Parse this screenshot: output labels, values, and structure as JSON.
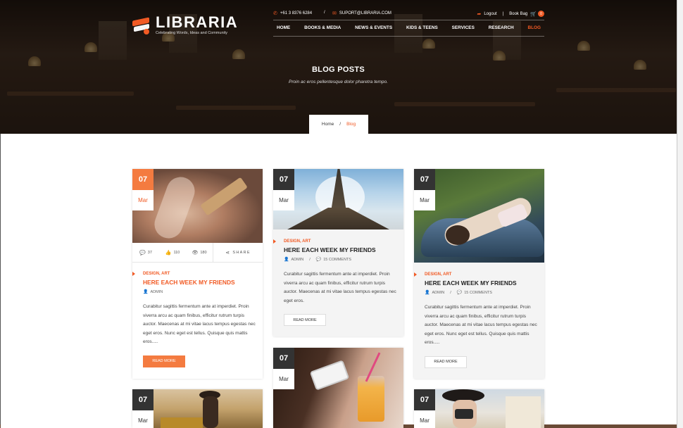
{
  "brand": {
    "name": "LIBRARIA",
    "tagline": "Celebrating Words, Ideas and Community"
  },
  "topbar": {
    "phone": "+61 3 8376 6284",
    "separator": "/",
    "email": "SUPORT@LIBRARIA.COM",
    "logout": "Logout",
    "pipe": "|",
    "bag": "Book Bag",
    "bag_count": "0"
  },
  "nav": [
    "HOME",
    "BOOKS & MEDIA",
    "NEWS & EVENTS",
    "KIDS & TEENS",
    "SERVICES",
    "RESEARCH",
    "BLOG"
  ],
  "hero": {
    "title": "BLOG POSTS",
    "subtitle": "Proin ac eros pellentesque dolor pharetra tempo."
  },
  "breadcrumb": {
    "home": "Home",
    "sep": "/",
    "current": "Blog"
  },
  "colors": {
    "accent": "#f15a24",
    "dark": "#333333"
  },
  "posts": [
    {
      "day": "07",
      "month": "Mar",
      "stats": {
        "comments": "37",
        "likes": "110",
        "views": "180",
        "share": "SHARE"
      },
      "category": "DESIGN, ART",
      "title": "HERE EACH WEEK MY FRIENDS",
      "author": "ADMIN",
      "excerpt": "Curabitur sagittis fermentum ante at imperdiet. Proin viverra arcu ac quam finibus, efficitur rutrum turpis auctor. Maecenas at mi vitae lacus tempus egestas nec eget eros. Nunc eget est tellus. Quisque quis mattis eros.....",
      "button": "READ MORE"
    },
    {
      "day": "07",
      "month": "Mar",
      "category": "DESIGN, ART",
      "title": "HERE EACH WEEK MY FRIENDS",
      "author": "ADMIN",
      "comments": "15 COMMENTS",
      "excerpt": "Curabitur sagittis fermentum ante at imperdiet. Proin viverra arcu ac quam finibus, efficitur rutrum turpis auctor. Maecenas at mi vitae lacus tempus egestas nec eget eros.",
      "button": "READ MORE"
    },
    {
      "day": "07",
      "month": "Mar",
      "category": "DESIGN, ART",
      "title": "HERE EACH WEEK MY FRIENDS",
      "author": "ADMIN",
      "comments": "15 COMMENTS",
      "excerpt": "Curabitur sagittis fermentum ante at imperdiet. Proin viverra arcu ac quam finibus, efficitur rutrum turpis auctor. Maecenas at mi vitae lacus tempus egestas nec eget eros. Nunc eget est tellus. Quisque quis mattis eros.....",
      "button": "READ MORE"
    },
    {
      "day": "07",
      "month": "Mar"
    },
    {
      "day": "07",
      "month": "Mar"
    },
    {
      "day": "07",
      "month": "Mar"
    }
  ]
}
